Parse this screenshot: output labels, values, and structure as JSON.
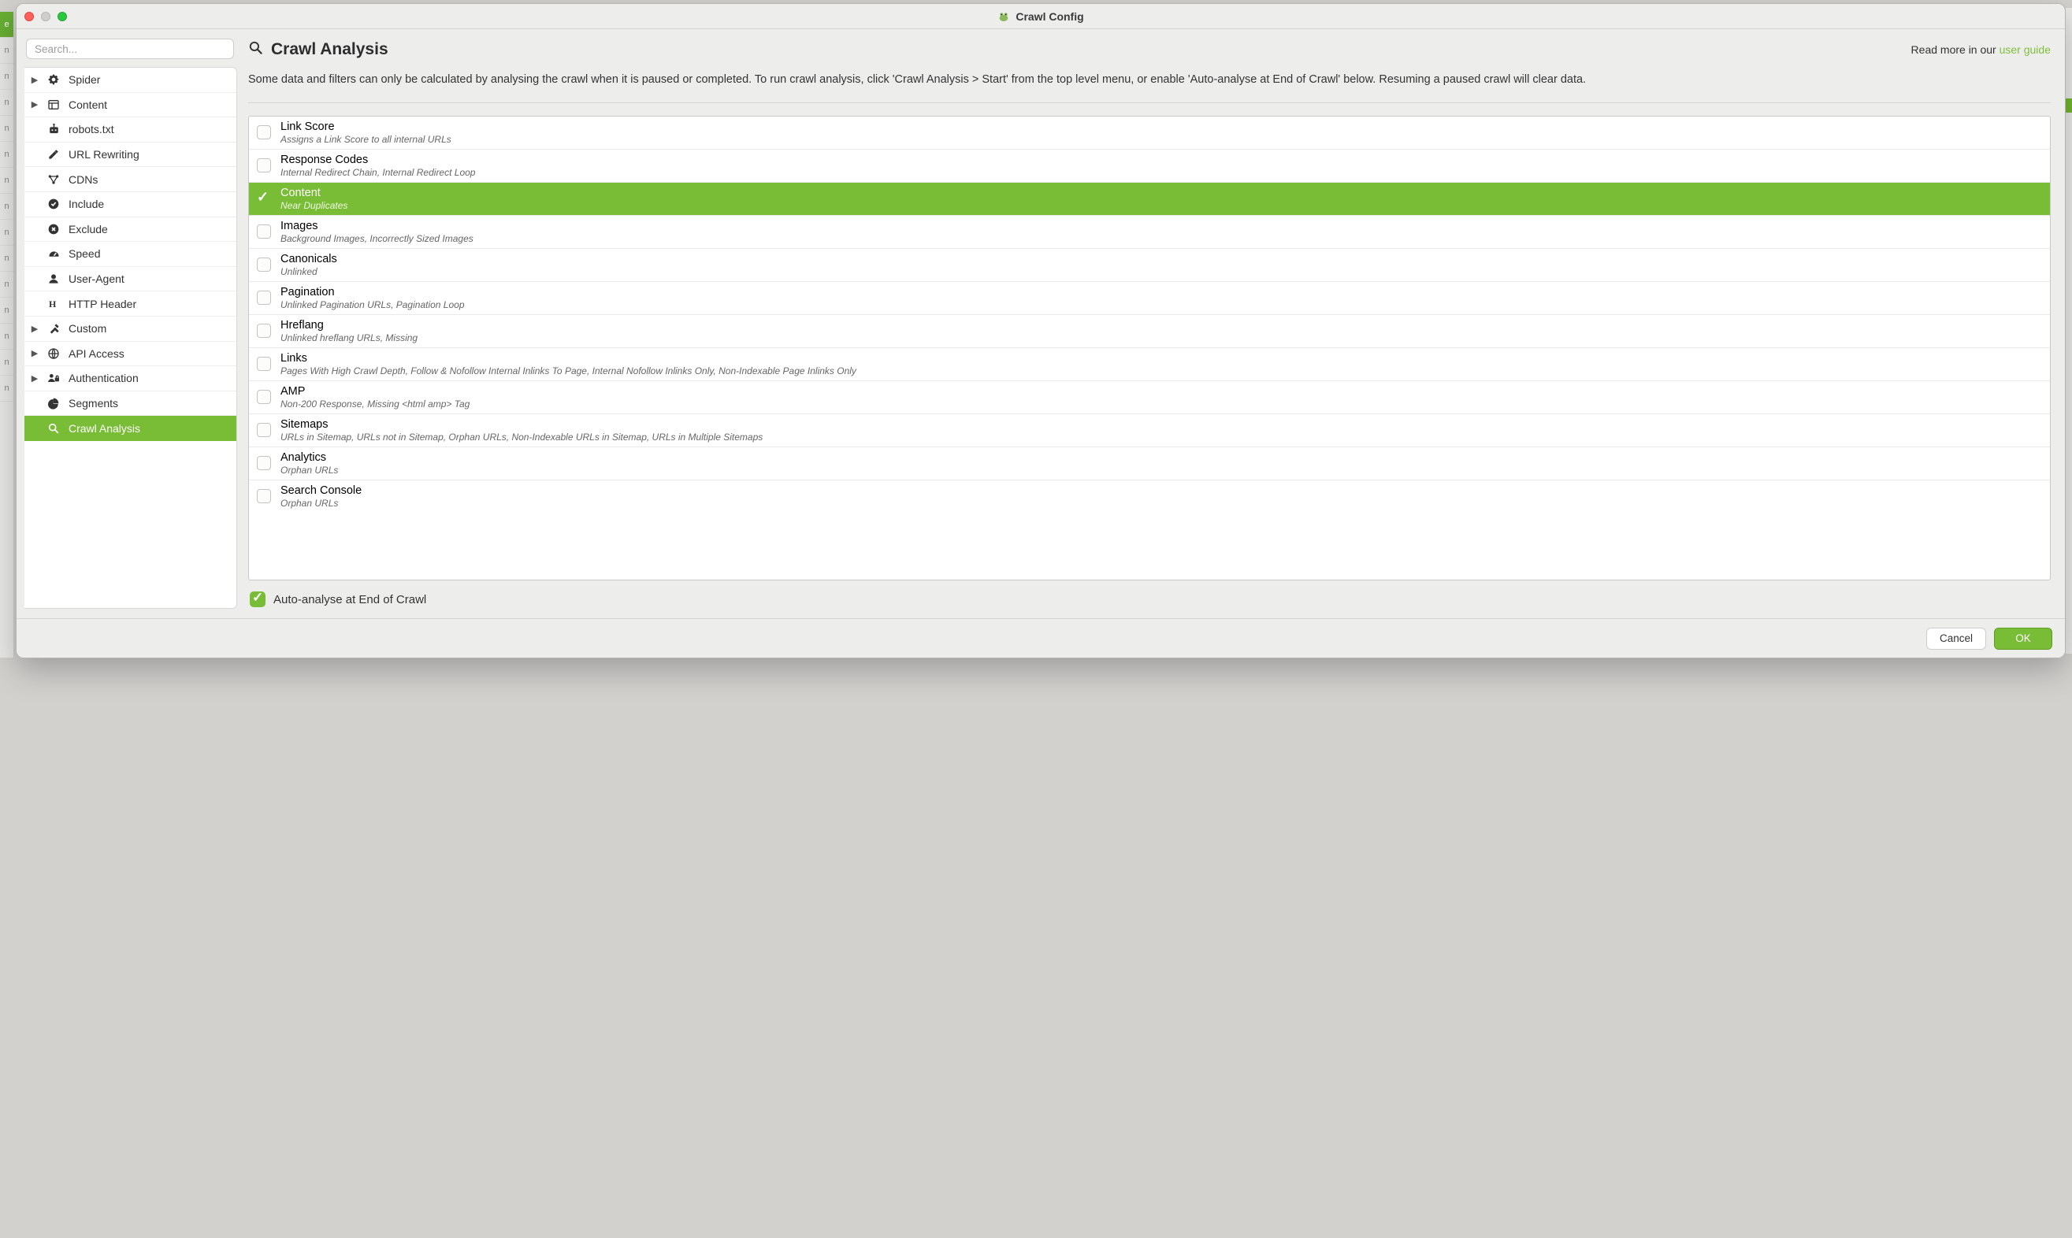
{
  "window": {
    "title": "Crawl Config"
  },
  "sidebar": {
    "search_placeholder": "Search...",
    "items": [
      {
        "label": "Spider",
        "expandable": true,
        "icon": "gear"
      },
      {
        "label": "Content",
        "expandable": true,
        "icon": "layout"
      },
      {
        "label": "robots.txt",
        "expandable": false,
        "icon": "robot"
      },
      {
        "label": "URL Rewriting",
        "expandable": false,
        "icon": "edit"
      },
      {
        "label": "CDNs",
        "expandable": false,
        "icon": "network"
      },
      {
        "label": "Include",
        "expandable": false,
        "icon": "check-circle"
      },
      {
        "label": "Exclude",
        "expandable": false,
        "icon": "x-circle"
      },
      {
        "label": "Speed",
        "expandable": false,
        "icon": "gauge"
      },
      {
        "label": "User-Agent",
        "expandable": false,
        "icon": "user"
      },
      {
        "label": "HTTP Header",
        "expandable": false,
        "icon": "h-letter"
      },
      {
        "label": "Custom",
        "expandable": true,
        "icon": "tools"
      },
      {
        "label": "API Access",
        "expandable": true,
        "icon": "globe"
      },
      {
        "label": "Authentication",
        "expandable": true,
        "icon": "lock-user"
      },
      {
        "label": "Segments",
        "expandable": false,
        "icon": "pie"
      },
      {
        "label": "Crawl Analysis",
        "expandable": false,
        "icon": "search",
        "selected": true
      }
    ]
  },
  "main": {
    "title": "Crawl Analysis",
    "readmore_prefix": "Read more in our ",
    "readmore_link": "user guide",
    "description": "Some data and filters can only be calculated by analysing the crawl when it is paused or completed. To run crawl analysis, click 'Crawl Analysis > Start' from the top level menu, or enable 'Auto-analyse at End of Crawl' below. Resuming a paused crawl will clear data.",
    "items": [
      {
        "label": "Link Score",
        "sub": "Assigns a Link Score to all internal URLs"
      },
      {
        "label": "Response Codes",
        "sub": "Internal Redirect Chain, Internal Redirect Loop"
      },
      {
        "label": "Content",
        "sub": "Near Duplicates",
        "selected": true
      },
      {
        "label": "Images",
        "sub": "Background Images, Incorrectly Sized Images"
      },
      {
        "label": "Canonicals",
        "sub": "Unlinked"
      },
      {
        "label": "Pagination",
        "sub": "Unlinked Pagination URLs, Pagination Loop"
      },
      {
        "label": "Hreflang",
        "sub": "Unlinked hreflang URLs, Missing"
      },
      {
        "label": "Links",
        "sub": "Pages With High Crawl Depth, Follow & Nofollow Internal Inlinks To Page, Internal Nofollow Inlinks Only, Non-Indexable Page Inlinks Only"
      },
      {
        "label": "AMP",
        "sub": "Non-200 Response, Missing <html amp> Tag"
      },
      {
        "label": "Sitemaps",
        "sub": "URLs in Sitemap, URLs not in Sitemap, Orphan URLs, Non-Indexable URLs in Sitemap, URLs in Multiple Sitemaps"
      },
      {
        "label": "Analytics",
        "sub": "Orphan URLs"
      },
      {
        "label": "Search Console",
        "sub": "Orphan URLs"
      }
    ],
    "auto_label": "Auto-analyse at End of Crawl",
    "auto_checked": true
  },
  "footer": {
    "cancel": "Cancel",
    "ok": "OK"
  }
}
